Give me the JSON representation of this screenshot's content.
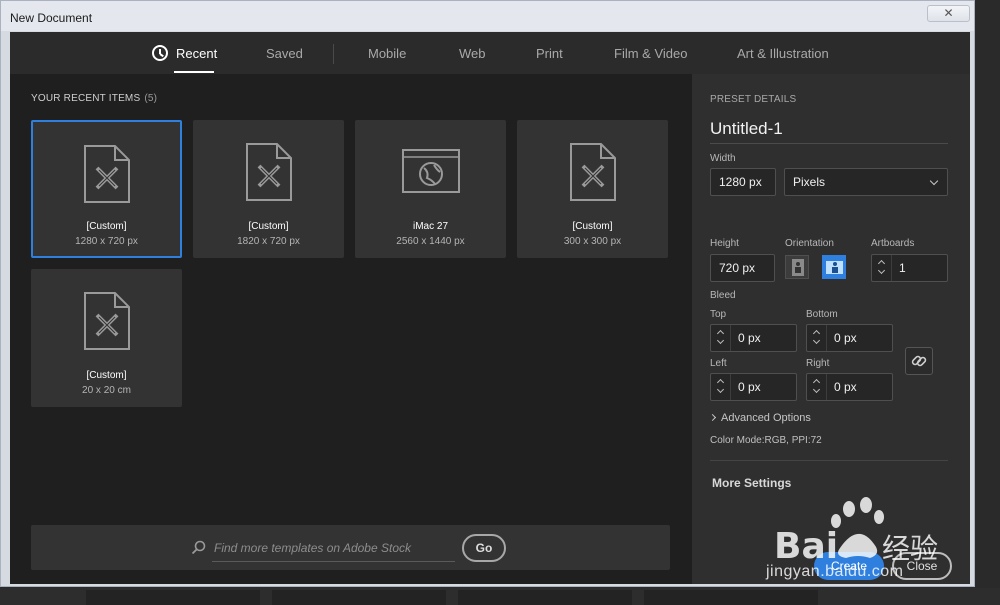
{
  "window": {
    "title": "New Document",
    "close_label": "✕"
  },
  "tabs": [
    {
      "label": "Recent",
      "active": true,
      "icon": "clock-icon"
    },
    {
      "label": "Saved"
    },
    {
      "label": "Mobile"
    },
    {
      "label": "Web"
    },
    {
      "label": "Print"
    },
    {
      "label": "Film & Video"
    },
    {
      "label": "Art & Illustration"
    }
  ],
  "recent": {
    "header": "YOUR RECENT ITEMS",
    "count": "(5)",
    "items": [
      {
        "name": "[Custom]",
        "size": "1280 x 720 px",
        "icon": "document-pencil-icon",
        "selected": true
      },
      {
        "name": "[Custom]",
        "size": "1820 x 720 px",
        "icon": "document-pencil-icon"
      },
      {
        "name": "iMac 27",
        "size": "2560 x 1440 px",
        "icon": "browser-globe-icon"
      },
      {
        "name": "[Custom]",
        "size": "300 x 300 px",
        "icon": "document-pencil-icon"
      },
      {
        "name": "[Custom]",
        "size": "20 x 20 cm",
        "icon": "document-pencil-icon"
      }
    ]
  },
  "search": {
    "placeholder": "Find more templates on Adobe Stock",
    "go_label": "Go"
  },
  "preset": {
    "heading": "PRESET DETAILS",
    "name": "Untitled-1",
    "width_label": "Width",
    "width_value": "1280 px",
    "unit": "Pixels",
    "height_label": "Height",
    "height_value": "720 px",
    "orientation_label": "Orientation",
    "artboards_label": "Artboards",
    "artboards_value": "1",
    "bleed_label": "Bleed",
    "top_label": "Top",
    "top_value": "0 px",
    "bottom_label": "Bottom",
    "bottom_value": "0 px",
    "left_label": "Left",
    "left_value": "0 px",
    "right_label": "Right",
    "right_value": "0 px",
    "advanced_label": "Advanced Options",
    "color_mode": "Color Mode:RGB, PPI:72",
    "more_settings": "More Settings",
    "create_label": "Create",
    "close_label": "Close"
  },
  "watermark": {
    "text": "jingyan.baidu.com"
  },
  "colors": {
    "accent": "#2e7fde",
    "panel": "#2f2f2f",
    "background": "#1f1f1f"
  }
}
